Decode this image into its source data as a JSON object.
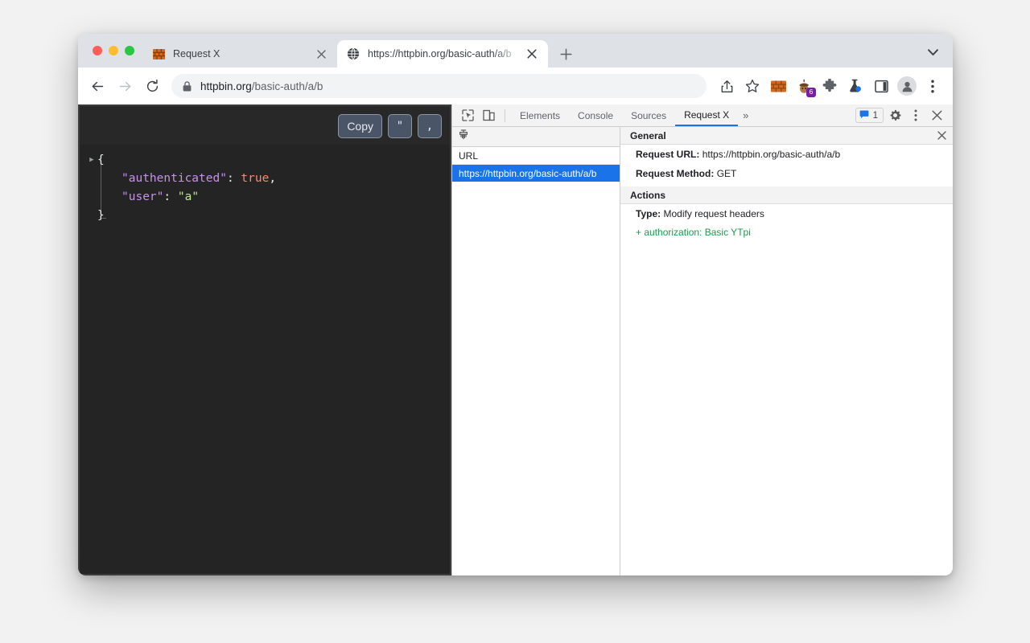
{
  "browser": {
    "window_controls": [
      "close",
      "minimize",
      "maximize"
    ],
    "tabs": [
      {
        "title": "Request X",
        "favicon": "brick-wall-icon",
        "active": false
      },
      {
        "title": "https://httpbin.org/basic-auth/a/b",
        "favicon": "globe-icon",
        "active": true
      }
    ],
    "new_tab_label": "+",
    "tab_search_icon": "chevron-down-icon",
    "toolbar": {
      "back_icon": "arrow-left-icon",
      "forward_icon": "arrow-right-icon",
      "reload_icon": "reload-icon",
      "lock_icon": "lock-icon",
      "url_host": "httpbin.org",
      "url_path": "/basic-auth/a/b",
      "share_icon": "share-icon",
      "bookmark_icon": "star-icon",
      "extensions": [
        {
          "name": "brick-wall-extension-icon",
          "badge": ""
        },
        {
          "name": "acorn-extension-icon",
          "badge": "6"
        },
        {
          "name": "puzzle-piece-icon",
          "badge": ""
        },
        {
          "name": "flask-extension-icon",
          "badge": ""
        },
        {
          "name": "side-panel-icon",
          "badge": ""
        }
      ],
      "profile_icon": "person-icon",
      "menu_icon": "kebab-menu-icon"
    }
  },
  "page": {
    "json_viewer": {
      "copy_button": "Copy",
      "quote_button": "\"",
      "comma_button": ",",
      "lines": [
        {
          "indent": 0,
          "disclosure": "▸",
          "tokens": [
            {
              "t": "brace",
              "v": "{"
            }
          ]
        },
        {
          "indent": 1,
          "disclosure": "",
          "tokens": [
            {
              "t": "key",
              "v": "\"authenticated\""
            },
            {
              "t": "colon",
              "v": ": "
            },
            {
              "t": "bool",
              "v": "true"
            },
            {
              "t": "punct",
              "v": ","
            }
          ]
        },
        {
          "indent": 1,
          "disclosure": "",
          "tokens": [
            {
              "t": "key",
              "v": "\"user\""
            },
            {
              "t": "colon",
              "v": ": "
            },
            {
              "t": "str",
              "v": "\"a\""
            }
          ]
        },
        {
          "indent": 0,
          "disclosure": "",
          "tokens": [
            {
              "t": "brace",
              "v": "}"
            }
          ]
        }
      ],
      "raw": {
        "authenticated": "true",
        "user": "a"
      }
    }
  },
  "devtools": {
    "inspect_icon": "inspect-element-icon",
    "device_icon": "device-toolbar-icon",
    "tabs": [
      {
        "label": "Elements",
        "active": false
      },
      {
        "label": "Console",
        "active": false
      },
      {
        "label": "Sources",
        "active": false
      },
      {
        "label": "Request X",
        "active": true
      }
    ],
    "overflow_label": "»",
    "message_count": "1",
    "message_icon": "message-bubble-icon",
    "settings_icon": "gear-icon",
    "more_icon": "kebab-menu-icon",
    "close_icon": "close-icon",
    "list_panel": {
      "clear_icon": "clear-broom-icon",
      "column_header": "URL",
      "rows": [
        {
          "url": "https://httpbin.org/basic-auth/a/b",
          "selected": true
        }
      ]
    },
    "details_panel": {
      "general": {
        "title": "General",
        "close_icon": "close-icon",
        "rows": [
          {
            "label": "Request URL:",
            "value": "https://httpbin.org/basic-auth/a/b"
          },
          {
            "label": "Request Method:",
            "value": "GET"
          }
        ]
      },
      "actions": {
        "title": "Actions",
        "type_label": "Type:",
        "type_value": "Modify request headers",
        "header_change": "+ authorization: Basic YTpi"
      }
    }
  },
  "colors": {
    "accent_blue": "#1a73e8",
    "green_text": "#1a9c4b",
    "tabstrip_bg": "#dee1e6",
    "page_bg": "#282828",
    "json_key": "#c792ea",
    "json_bool": "#f78c6c",
    "json_string": "#c3e88d",
    "badge_purple": "#7b1fa2"
  }
}
